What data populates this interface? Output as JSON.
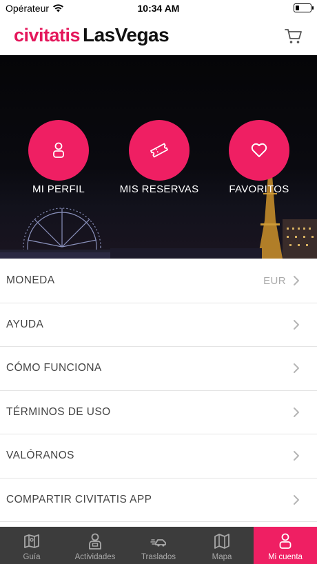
{
  "status_bar": {
    "carrier": "Opérateur",
    "time": "10:34 AM"
  },
  "header": {
    "brand": "civitatis",
    "city": "LasVegas"
  },
  "hero": {
    "buttons": [
      {
        "label": "MI PERFIL",
        "icon": "person-icon"
      },
      {
        "label": "MIS RESERVAS",
        "icon": "ticket-icon"
      },
      {
        "label": "FAVORITOS",
        "icon": "heart-icon"
      }
    ]
  },
  "menu": [
    {
      "label": "MONEDA",
      "value": "EUR"
    },
    {
      "label": "AYUDA",
      "value": ""
    },
    {
      "label": "CÓMO FUNCIONA",
      "value": ""
    },
    {
      "label": "TÉRMINOS DE USO",
      "value": ""
    },
    {
      "label": "VALÓRANOS",
      "value": ""
    },
    {
      "label": "COMPARTIR CIVITATIS APP",
      "value": ""
    }
  ],
  "tabs": [
    {
      "label": "Guía",
      "icon": "map-book-icon",
      "active": false
    },
    {
      "label": "Actividades",
      "icon": "guide-person-icon",
      "active": false
    },
    {
      "label": "Traslados",
      "icon": "transfer-car-icon",
      "active": false
    },
    {
      "label": "Mapa",
      "icon": "map-icon",
      "active": false
    },
    {
      "label": "Mi cuenta",
      "icon": "account-icon",
      "active": true
    }
  ],
  "colors": {
    "brand": "#e4175b",
    "accent": "#ef1f63",
    "tab_bar": "#3c3c3c"
  }
}
